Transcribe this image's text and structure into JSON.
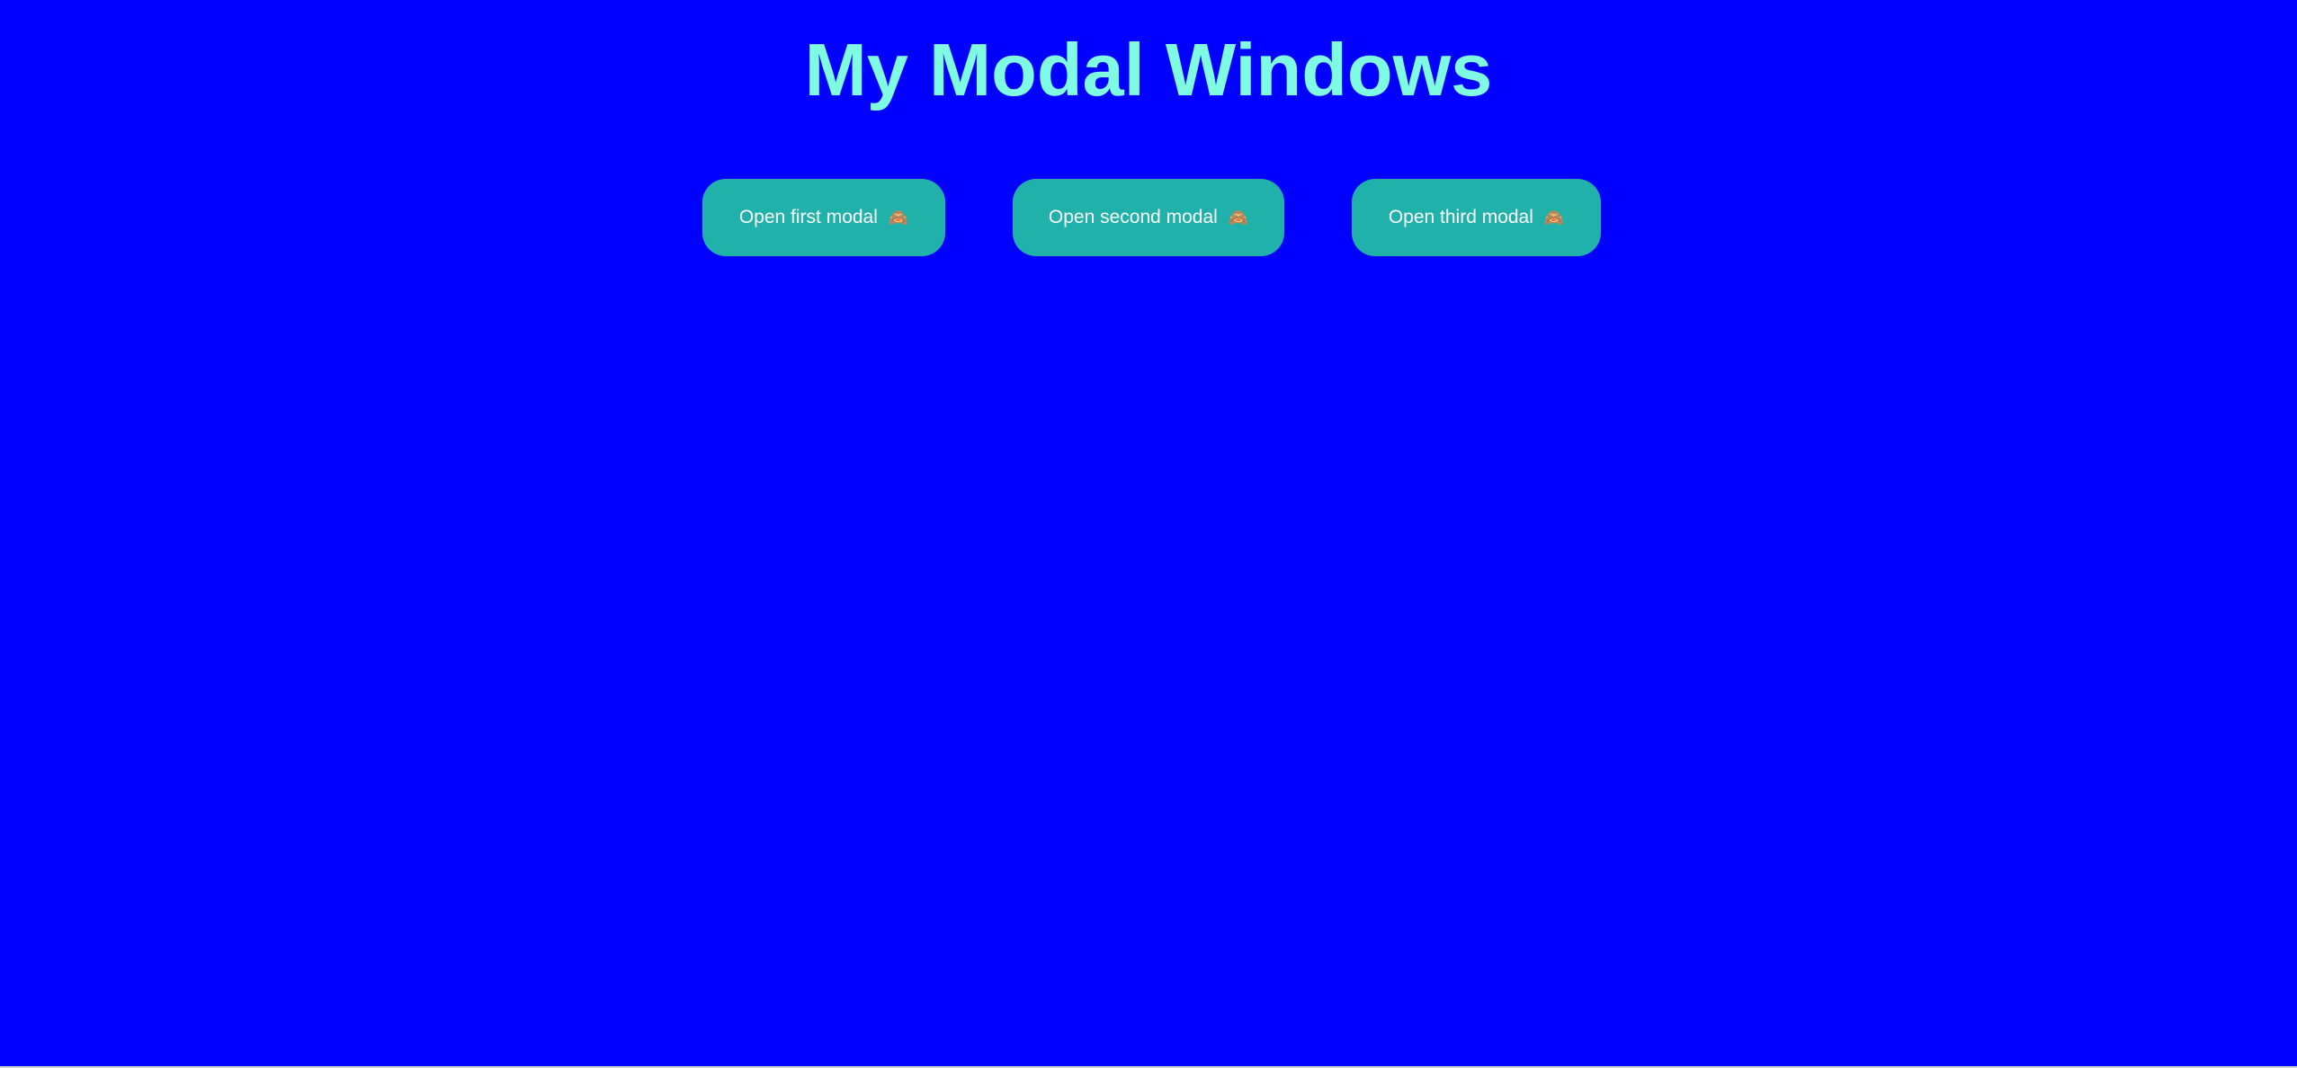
{
  "page": {
    "title": "My Modal Windows",
    "colors": {
      "background": "#0000ff",
      "title": "#7ffbe4",
      "button": "#20b2aa",
      "button_text": "#ffffff"
    }
  },
  "buttons": [
    {
      "label": "Open first modal",
      "icon": "see-no-evil-monkey-icon",
      "glyph": "🙈"
    },
    {
      "label": "Open second modal",
      "icon": "see-no-evil-monkey-icon",
      "glyph": "🙈"
    },
    {
      "label": "Open third modal",
      "icon": "see-no-evil-monkey-icon",
      "glyph": "🙈"
    }
  ]
}
